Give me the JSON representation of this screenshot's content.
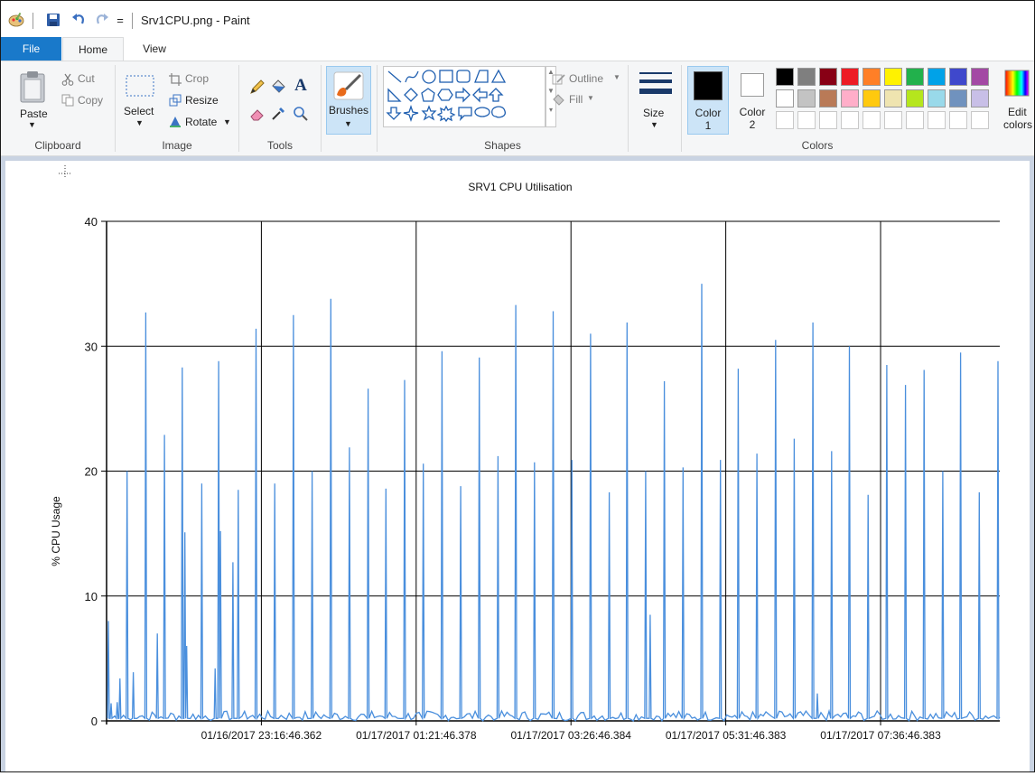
{
  "window": {
    "title": "Srv1CPU.png - Paint",
    "qat_dropdown": "="
  },
  "tabs": [
    {
      "label": "File"
    },
    {
      "label": "Home"
    },
    {
      "label": "View"
    }
  ],
  "ribbon": {
    "clipboard": {
      "group_label": "Clipboard",
      "paste": "Paste",
      "cut": "Cut",
      "copy": "Copy"
    },
    "image": {
      "group_label": "Image",
      "select": "Select",
      "crop": "Crop",
      "resize": "Resize",
      "rotate": "Rotate"
    },
    "tools": {
      "group_label": "Tools"
    },
    "brushes": {
      "label": "Brushes"
    },
    "shapes": {
      "group_label": "Shapes",
      "outline": "Outline",
      "fill": "Fill"
    },
    "size": {
      "label": "Size"
    },
    "colors": {
      "group_label": "Colors",
      "color1_label": "Color",
      "color1_num": "1",
      "color2_label": "Color",
      "color2_num": "2",
      "edit_label_1": "Edit",
      "edit_label_2": "colors",
      "color1": "#000000",
      "color2": "#ffffff",
      "palette_row1": [
        "#000000",
        "#7f7f7f",
        "#880015",
        "#ed1c24",
        "#ff7f27",
        "#fff200",
        "#22b14c",
        "#00a2e8",
        "#3f48cc",
        "#a349a4"
      ],
      "palette_row2": [
        "#ffffff",
        "#c3c3c3",
        "#b97a57",
        "#ffaec9",
        "#ffc90e",
        "#efe4b0",
        "#b5e61d",
        "#99d9ea",
        "#7092be",
        "#c8bfe7"
      ]
    }
  },
  "chart_data": {
    "type": "line",
    "title": "SRV1 CPU Utilisation",
    "xlabel": "",
    "ylabel": "% CPU Usage",
    "ylim": [
      0,
      40
    ],
    "yticks": [
      0,
      10,
      20,
      30,
      40
    ],
    "xticks": [
      "01/16/2017 23:16:46.362",
      "01/17/2017 01:21:46.378",
      "01/17/2017 03:26:46.384",
      "01/17/2017 05:31:46.383",
      "01/17/2017 07:36:46.383"
    ],
    "grid": true,
    "series": [
      {
        "color": "#4a8fdd",
        "spikes": [
          {
            "x": 0.0,
            "y": 8.0
          },
          {
            "x": 0.003,
            "y": 1.4
          },
          {
            "x": 0.01,
            "y": 1.5
          },
          {
            "x": 0.013,
            "y": 3.4
          },
          {
            "x": 0.021,
            "y": 20.0
          },
          {
            "x": 0.028,
            "y": 3.9
          },
          {
            "x": 0.042,
            "y": 32.7
          },
          {
            "x": 0.055,
            "y": 7.0
          },
          {
            "x": 0.063,
            "y": 22.9
          },
          {
            "x": 0.083,
            "y": 28.3
          },
          {
            "x": 0.086,
            "y": 15.1
          },
          {
            "x": 0.088,
            "y": 6.0
          },
          {
            "x": 0.105,
            "y": 19.0
          },
          {
            "x": 0.12,
            "y": 4.2
          },
          {
            "x": 0.124,
            "y": 28.8
          },
          {
            "x": 0.126,
            "y": 15.2
          },
          {
            "x": 0.14,
            "y": 12.7
          },
          {
            "x": 0.146,
            "y": 18.5
          },
          {
            "x": 0.166,
            "y": 31.4
          },
          {
            "x": 0.187,
            "y": 19.0
          },
          {
            "x": 0.208,
            "y": 32.5
          },
          {
            "x": 0.229,
            "y": 20.0
          },
          {
            "x": 0.25,
            "y": 33.8
          },
          {
            "x": 0.271,
            "y": 21.9
          },
          {
            "x": 0.292,
            "y": 26.6
          },
          {
            "x": 0.312,
            "y": 18.6
          },
          {
            "x": 0.333,
            "y": 27.3
          },
          {
            "x": 0.354,
            "y": 20.6
          },
          {
            "x": 0.375,
            "y": 29.6
          },
          {
            "x": 0.396,
            "y": 18.8
          },
          {
            "x": 0.417,
            "y": 29.1
          },
          {
            "x": 0.438,
            "y": 21.2
          },
          {
            "x": 0.458,
            "y": 33.3
          },
          {
            "x": 0.479,
            "y": 20.7
          },
          {
            "x": 0.5,
            "y": 32.8
          },
          {
            "x": 0.521,
            "y": 20.9
          },
          {
            "x": 0.542,
            "y": 31.0
          },
          {
            "x": 0.563,
            "y": 18.3
          },
          {
            "x": 0.583,
            "y": 31.9
          },
          {
            "x": 0.604,
            "y": 20.0
          },
          {
            "x": 0.609,
            "y": 8.5
          },
          {
            "x": 0.625,
            "y": 27.2
          },
          {
            "x": 0.646,
            "y": 20.3
          },
          {
            "x": 0.667,
            "y": 35.0
          },
          {
            "x": 0.688,
            "y": 20.9
          },
          {
            "x": 0.708,
            "y": 28.2
          },
          {
            "x": 0.729,
            "y": 21.4
          },
          {
            "x": 0.75,
            "y": 30.5
          },
          {
            "x": 0.771,
            "y": 22.6
          },
          {
            "x": 0.792,
            "y": 31.9
          },
          {
            "x": 0.797,
            "y": 2.2
          },
          {
            "x": 0.813,
            "y": 21.6
          },
          {
            "x": 0.833,
            "y": 30.0
          },
          {
            "x": 0.854,
            "y": 18.1
          },
          {
            "x": 0.875,
            "y": 28.5
          },
          {
            "x": 0.896,
            "y": 26.9
          },
          {
            "x": 0.917,
            "y": 28.1
          },
          {
            "x": 0.938,
            "y": 20.0
          },
          {
            "x": 0.958,
            "y": 29.5
          },
          {
            "x": 0.979,
            "y": 18.3
          },
          {
            "x": 1.0,
            "y": 28.8
          }
        ]
      }
    ]
  }
}
